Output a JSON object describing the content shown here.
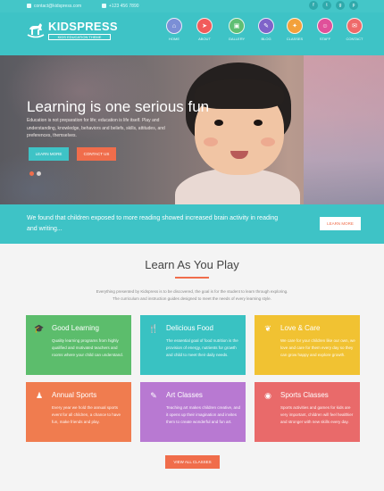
{
  "topbar": {
    "email": "contact@kidspress.com",
    "phone": "+123 456 7890",
    "social": [
      {
        "icon": "facebook-icon",
        "glyph": "f"
      },
      {
        "icon": "twitter-icon",
        "glyph": "t"
      },
      {
        "icon": "google-plus-icon",
        "glyph": "g"
      },
      {
        "icon": "pinterest-icon",
        "glyph": "p"
      }
    ]
  },
  "header": {
    "logo_title": "KIDSPRESS",
    "logo_tagline": "KIDS EDUCATION THEME",
    "nav": [
      {
        "label": "HOME",
        "icon": "home-icon",
        "glyph": "⌂",
        "color": "#7b8fd6"
      },
      {
        "label": "ABOUT",
        "icon": "paper-plane-icon",
        "glyph": "➤",
        "color": "#f15b5b"
      },
      {
        "label": "GALLERY",
        "icon": "gallery-icon",
        "glyph": "▣",
        "color": "#5fbf73"
      },
      {
        "label": "BLOG",
        "icon": "blog-icon",
        "glyph": "✎",
        "color": "#7f63c9"
      },
      {
        "label": "CLASSES",
        "icon": "classes-icon",
        "glyph": "✦",
        "color": "#f3a13b"
      },
      {
        "label": "STAFF",
        "icon": "staff-icon",
        "glyph": "☺",
        "color": "#e0509a"
      },
      {
        "label": "CONTACT",
        "icon": "contact-icon",
        "glyph": "✉",
        "color": "#ef6a6a"
      }
    ]
  },
  "hero": {
    "title": "Learning is one serious fun",
    "text": "Education is not preparation for life; education is life itself. Play and understanding, knowledge, behaviors and beliefs, skills, attitudes, and preferences, themselves.",
    "primary_button": "LEARN MORE",
    "secondary_button": "CONTACT US"
  },
  "banner": {
    "text": "We found that children exposed to more reading showed increased brain activity in reading and writing...",
    "button": "LEARN MORE"
  },
  "section": {
    "title": "Learn As You Play",
    "intro": "Everything presented by Kidspress is to be discovered, the goal is for the student to learn through exploring. The curriculum and instruction guides designed to meet the needs of every learning style."
  },
  "cards": [
    {
      "title": "Good Learning",
      "icon": "graduation-cap-icon",
      "glyph": "🎓",
      "color": "#5cbd6c",
      "text": "Quality learning programs from highly qualified and motivated teachers and rooms where your child can understand."
    },
    {
      "title": "Delicious Food",
      "icon": "food-icon",
      "glyph": "🍴",
      "color": "#39c2c2",
      "text": "The essential goal of food nutrition is the provision of energy, nutrients for growth and child to meet their daily needs."
    },
    {
      "title": "Love & Care",
      "icon": "leaf-icon",
      "glyph": "❦",
      "color": "#f1c232",
      "text": "We care for your children like our own, we love and care for them every day so they can grow happy and explore growth."
    },
    {
      "title": "Annual Sports",
      "icon": "person-icon",
      "glyph": "♟",
      "color": "#f07c4f",
      "text": "Every year we hold the annual sports event for all children, a chance to have fun, make friends and play."
    },
    {
      "title": "Art Classes",
      "icon": "art-icon",
      "glyph": "✎",
      "color": "#b879d2",
      "text": "Teaching art makes children creative, and it opens up their imagination and invites them to create wonderful and fun art."
    },
    {
      "title": "Sports Classes",
      "icon": "gamepad-icon",
      "glyph": "◉",
      "color": "#e96a6a",
      "text": "Sports activities and games for kids are very important, children will feel healthier and stronger with new skills every day."
    }
  ],
  "view_all_button": "VIEW ALL CLASSES"
}
